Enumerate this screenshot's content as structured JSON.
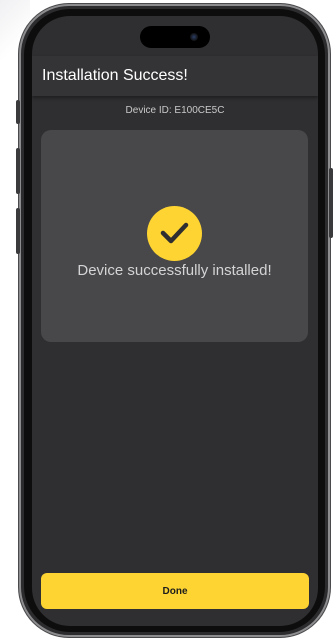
{
  "app": {
    "title": "Installation Success!"
  },
  "device": {
    "id_label": "Device ID: E100CE5C"
  },
  "status": {
    "message": "Device successfully installed!",
    "icon": "check-circle-icon"
  },
  "actions": {
    "done_label": "Done"
  },
  "colors": {
    "accent": "#fdd431",
    "background": "#2f2e30",
    "card": "#48474a",
    "appbar": "#343335"
  }
}
